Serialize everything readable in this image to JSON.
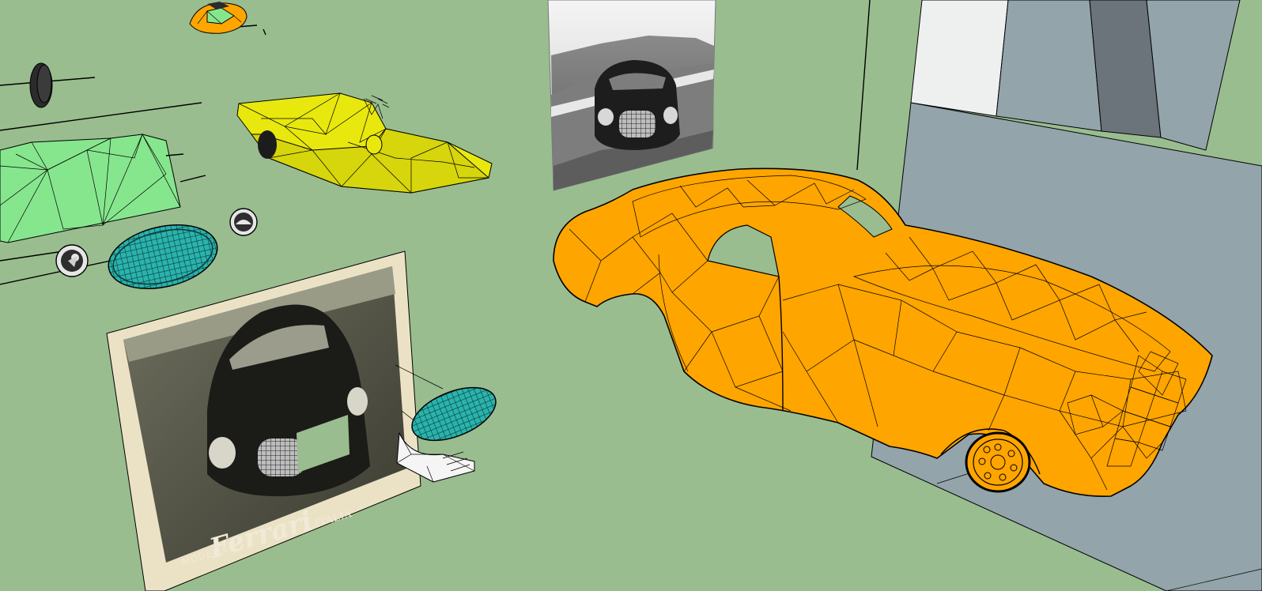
{
  "colors": {
    "background": "#99bd8f",
    "car_body": "#ffa500",
    "chassis": "#e8e80e",
    "body_panel": "#86e68e",
    "grille": "#2ab3ad",
    "wall_light": "#93a4ab",
    "wall_dark": "#6a747a",
    "wall_white": "#eef0f0",
    "photo_sepia": "#ebe2c6"
  },
  "icons": {
    "reference_photo_1": "photo-icon",
    "reference_photo_2": "photo-icon",
    "headlight": "headlight-icon",
    "wheel": "wheel-icon"
  },
  "poster": {
    "brand": "Ferrari",
    "city": "MODENA",
    "country": "ITALIA"
  }
}
